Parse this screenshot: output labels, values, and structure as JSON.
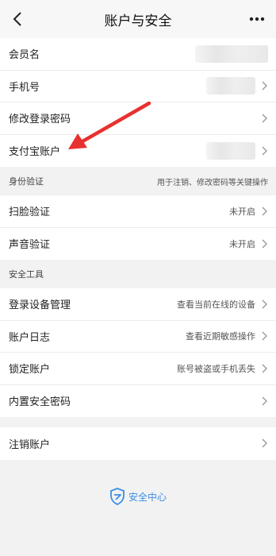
{
  "nav": {
    "title": "账户与安全",
    "back_icon": "chevron-left-icon",
    "more_icon": "more-dots-icon"
  },
  "account": {
    "items": [
      {
        "label": "会员名",
        "value_blurred": true
      },
      {
        "label": "手机号",
        "value_blurred": true
      },
      {
        "label": "修改登录密码"
      },
      {
        "label": "支付宝账户",
        "value_blurred": true
      }
    ]
  },
  "identity": {
    "header": "身份验证",
    "note": "用于注销、修改密码等关键操作",
    "items": [
      {
        "label": "扫脸验证",
        "value": "未开启"
      },
      {
        "label": "声音验证",
        "value": "未开启"
      }
    ]
  },
  "tools": {
    "header": "安全工具",
    "items": [
      {
        "label": "登录设备管理",
        "value": "查看当前在线的设备"
      },
      {
        "label": "账户日志",
        "value": "查看近期敏感操作"
      },
      {
        "label": "锁定账户",
        "value": "账号被盗或手机丢失"
      },
      {
        "label": "内置安全密码"
      }
    ]
  },
  "cancel": {
    "label": "注销账户"
  },
  "footer": {
    "text": "安全中心",
    "icon": "shield-icon",
    "accent": "#3a8ee6"
  },
  "annotation": {
    "color": "#e8312f"
  }
}
